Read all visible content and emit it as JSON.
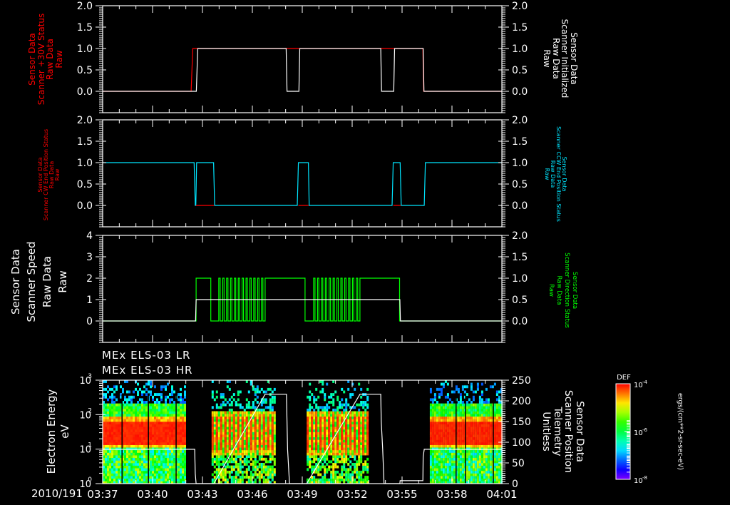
{
  "xaxis": {
    "date": "2010/191",
    "range": [
      "03:37:00",
      "04:01:00"
    ],
    "ticks": [
      "03:37",
      "03:40",
      "03:43",
      "03:46",
      "03:49",
      "03:52",
      "03:55",
      "03:58",
      "04:01"
    ]
  },
  "chart_data": [
    {
      "type": "line",
      "ylabel_left": [
        "Sensor Data",
        "Scanner +30V Status",
        "Raw Data",
        "Raw"
      ],
      "ylabel_left_color": "#ff0000",
      "ylabel_right": [
        "Sensor Data",
        "Scanner Initialized",
        "Raw Data",
        "Raw"
      ],
      "ylabel_right_color": "#ffffff",
      "ylim_left": [
        -0.5,
        2.0
      ],
      "ylim_right": [
        -0.5,
        2.0
      ],
      "yticks_left": [
        "0.0",
        "0.5",
        "1.0",
        "1.5",
        "2.0"
      ],
      "yticks_right": [
        "0.0",
        "0.5",
        "1.0",
        "1.5",
        "2.0"
      ],
      "series": [
        {
          "axis": "left",
          "color": "#ff0000",
          "points": [
            [
              "03:37:00",
              0
            ],
            [
              "03:42:19",
              0
            ],
            [
              "03:42:25",
              1
            ],
            [
              "03:56:15",
              1
            ],
            [
              "03:56:18",
              0
            ],
            [
              "04:01:00",
              0
            ]
          ]
        },
        {
          "axis": "right",
          "color": "#ffffff",
          "points": [
            [
              "03:37:00",
              0
            ],
            [
              "03:42:38",
              0
            ],
            [
              "03:42:43",
              1
            ],
            [
              "03:48:02",
              1
            ],
            [
              "03:48:05",
              0
            ],
            [
              "03:48:48",
              0
            ],
            [
              "03:48:51",
              1
            ],
            [
              "03:53:43",
              1
            ],
            [
              "03:53:46",
              0
            ],
            [
              "03:54:30",
              0
            ],
            [
              "03:54:33",
              1
            ],
            [
              "03:56:16",
              1
            ],
            [
              "03:56:19",
              0
            ],
            [
              "04:01:00",
              0
            ]
          ]
        }
      ]
    },
    {
      "type": "line",
      "ylabel_left": [
        "Sensor Data",
        "Scanner CW End Position Status",
        "Raw Data",
        "Raw"
      ],
      "ylabel_left_color": "#ff0000",
      "ylabel_right": [
        "Sensor Data",
        "Scanner CCW End Position Status",
        "Raw Data",
        "Raw"
      ],
      "ylabel_right_color": "#00e5ff",
      "ylim_left": [
        -0.5,
        2.0
      ],
      "ylim_right": [
        -0.5,
        2.0
      ],
      "yticks_left": [
        "0.0",
        "0.5",
        "1.0",
        "1.5",
        "2.0"
      ],
      "yticks_right": [
        "0.0",
        "0.5",
        "1.0",
        "1.5",
        "2.0"
      ],
      "series": [
        {
          "axis": "right",
          "color": "#00e5ff",
          "points": [
            [
              "03:37:00",
              1
            ],
            [
              "03:42:30",
              1
            ],
            [
              "03:42:34",
              0
            ],
            [
              "03:42:36",
              0
            ],
            [
              "03:42:39",
              1
            ],
            [
              "03:43:40",
              1
            ],
            [
              "03:43:44",
              0
            ],
            [
              "03:48:42",
              0
            ],
            [
              "03:48:46",
              1
            ],
            [
              "03:49:22",
              1
            ],
            [
              "03:49:25",
              0
            ],
            [
              "03:54:24",
              0
            ],
            [
              "03:54:28",
              1
            ],
            [
              "03:54:53",
              1
            ],
            [
              "03:54:57",
              0
            ],
            [
              "03:56:20",
              0
            ],
            [
              "03:56:24",
              1
            ],
            [
              "04:01:00",
              1
            ]
          ]
        },
        {
          "axis": "left",
          "color": "#ff0000",
          "points": [
            [
              "03:42:36",
              0
            ],
            [
              "03:43:42",
              0
            ],
            [
              null
            ],
            [
              "03:48:46",
              0
            ],
            [
              "03:49:23",
              0
            ],
            [
              null
            ],
            [
              "03:54:28",
              0
            ],
            [
              "03:54:55",
              0
            ]
          ]
        }
      ]
    },
    {
      "type": "line",
      "ylabel_left": [
        "Sensor Data",
        "Scanner Speed",
        "Raw Data",
        "Raw"
      ],
      "ylabel_left_color": "#ffffff",
      "ylabel_right": [
        "Sensor Data",
        "Scanner Direction Status",
        "Raw Data",
        "Raw"
      ],
      "ylabel_right_color": "#00ff00",
      "ylim_left": [
        -1,
        4
      ],
      "ylim_right": [
        -0.5,
        2.0
      ],
      "yticks_left": [
        "0",
        "1",
        "2",
        "3",
        "4"
      ],
      "yticks_right": [
        "0.0",
        "0.5",
        "1.0",
        "1.5",
        "2.0"
      ],
      "series": [
        {
          "axis": "right",
          "color": "#00ff00",
          "step": true,
          "points": [
            [
              "03:37:00",
              0
            ],
            [
              "03:42:37",
              1
            ],
            [
              "03:43:30",
              0
            ],
            [
              "03:43:59",
              1
            ],
            [
              "03:44:04",
              0
            ],
            [
              "03:44:13",
              1
            ],
            [
              "03:44:18",
              0
            ],
            [
              "03:44:27",
              1
            ],
            [
              "03:44:32",
              0
            ],
            [
              "03:44:41",
              1
            ],
            [
              "03:44:46",
              0
            ],
            [
              "03:44:55",
              1
            ],
            [
              "03:45:00",
              0
            ],
            [
              "03:45:09",
              1
            ],
            [
              "03:45:14",
              0
            ],
            [
              "03:45:23",
              1
            ],
            [
              "03:45:28",
              0
            ],
            [
              "03:45:37",
              1
            ],
            [
              "03:45:42",
              0
            ],
            [
              "03:45:51",
              1
            ],
            [
              "03:45:56",
              0
            ],
            [
              "03:46:05",
              1
            ],
            [
              "03:46:10",
              0
            ],
            [
              "03:46:19",
              1
            ],
            [
              "03:46:24",
              0
            ],
            [
              "03:46:33",
              1
            ],
            [
              "03:46:38",
              0
            ],
            [
              "03:46:46",
              1
            ],
            [
              "03:49:10",
              0
            ],
            [
              "03:49:41",
              1
            ],
            [
              "03:49:46",
              0
            ],
            [
              "03:49:55",
              1
            ],
            [
              "03:50:00",
              0
            ],
            [
              "03:50:09",
              1
            ],
            [
              "03:50:14",
              0
            ],
            [
              "03:50:23",
              1
            ],
            [
              "03:50:28",
              0
            ],
            [
              "03:50:37",
              1
            ],
            [
              "03:50:42",
              0
            ],
            [
              "03:50:51",
              1
            ],
            [
              "03:50:56",
              0
            ],
            [
              "03:51:05",
              1
            ],
            [
              "03:51:10",
              0
            ],
            [
              "03:51:19",
              1
            ],
            [
              "03:51:24",
              0
            ],
            [
              "03:51:33",
              1
            ],
            [
              "03:51:38",
              0
            ],
            [
              "03:51:47",
              1
            ],
            [
              "03:51:52",
              0
            ],
            [
              "03:52:01",
              1
            ],
            [
              "03:52:06",
              0
            ],
            [
              "03:52:15",
              1
            ],
            [
              "03:52:20",
              0
            ],
            [
              "03:52:28",
              1
            ],
            [
              "03:54:51",
              0
            ],
            [
              "04:01:00",
              0
            ]
          ]
        },
        {
          "axis": "left",
          "color": "#ffffff",
          "points": [
            [
              "03:37:00",
              0
            ],
            [
              "03:42:35",
              0
            ],
            [
              "03:42:37",
              1
            ],
            [
              "03:54:52",
              1
            ],
            [
              "03:54:54",
              0
            ],
            [
              "04:01:00",
              0
            ]
          ]
        }
      ]
    },
    {
      "type": "heatmap",
      "titles": [
        "MEx ELS-03 LR",
        "MEx ELS-03 HR"
      ],
      "ylabel_left": [
        "Electron Energy",
        "eV"
      ],
      "ylabel_left_color": "#ffffff",
      "ylabel_right": [
        "Sensor Data",
        "Scanner Position",
        "Telemetry",
        "Unitless"
      ],
      "ylabel_right_color": "#ffffff",
      "yscale_left": "log",
      "ylim_left": [
        1,
        1000
      ],
      "yticks_left": [
        {
          "base": "10",
          "exp": "0"
        },
        {
          "base": "10",
          "exp": "1"
        },
        {
          "base": "10",
          "exp": "2"
        },
        {
          "base": "10",
          "exp": "3"
        }
      ],
      "ylim_right": [
        0,
        250
      ],
      "yticks_right": [
        "0",
        "50",
        "100",
        "150",
        "200",
        "250"
      ],
      "colorbar": {
        "label": "DEF",
        "units": "ergs/(cm**2-sr-sec-eV)",
        "range_log10": [
          -8,
          -4
        ],
        "colormap": "rainbow",
        "ticks": [
          {
            "base": "10",
            "exp": "-4"
          },
          {
            "base": "10",
            "exp": "-6"
          },
          {
            "base": "10",
            "exp": "-8"
          }
        ]
      },
      "spectrogram": {
        "segments": [
          {
            "start": "03:37:00",
            "end": "03:41:56",
            "mode": "steady",
            "peak_band_eV": [
              14,
              76
            ]
          },
          {
            "start": "03:43:33",
            "end": "03:47:20",
            "mode": "sweep",
            "peak_band_eV": [
              7,
              120
            ]
          },
          {
            "start": "03:49:16",
            "end": "03:52:59",
            "mode": "sweep",
            "peak_band_eV": [
              7,
              120
            ]
          },
          {
            "start": "03:56:40",
            "end": "04:01:00",
            "mode": "steady",
            "peak_band_eV": [
              14,
              76
            ]
          }
        ],
        "data_gaps": [
          "03:38:10",
          "03:39:45",
          "03:41:25",
          "03:58:15",
          "03:58:49",
          "04:00:29"
        ]
      },
      "series": [
        {
          "axis": "right",
          "color": "#ffffff",
          "points": [
            [
              "03:37:00",
              83
            ],
            [
              "03:42:32",
              83
            ],
            [
              "03:42:34",
              24
            ],
            [
              "03:42:37",
              0
            ],
            [
              "03:43:41",
              0
            ],
            [
              "03:46:46",
              216
            ],
            [
              "03:48:03",
              216
            ],
            [
              "03:48:07",
              83
            ],
            [
              "03:48:14",
              0
            ],
            [
              "03:49:16",
              0
            ],
            [
              "03:52:28",
              216
            ],
            [
              "03:53:43",
              216
            ],
            [
              "03:53:45",
              150
            ],
            [
              "03:53:50",
              83
            ],
            [
              "03:53:55",
              0
            ],
            [
              "03:54:52",
              0
            ],
            [
              "03:54:53",
              7
            ],
            [
              "03:56:15",
              7
            ],
            [
              "03:56:16",
              65
            ],
            [
              "03:56:20",
              83
            ],
            [
              "04:01:00",
              83
            ]
          ]
        }
      ]
    }
  ]
}
